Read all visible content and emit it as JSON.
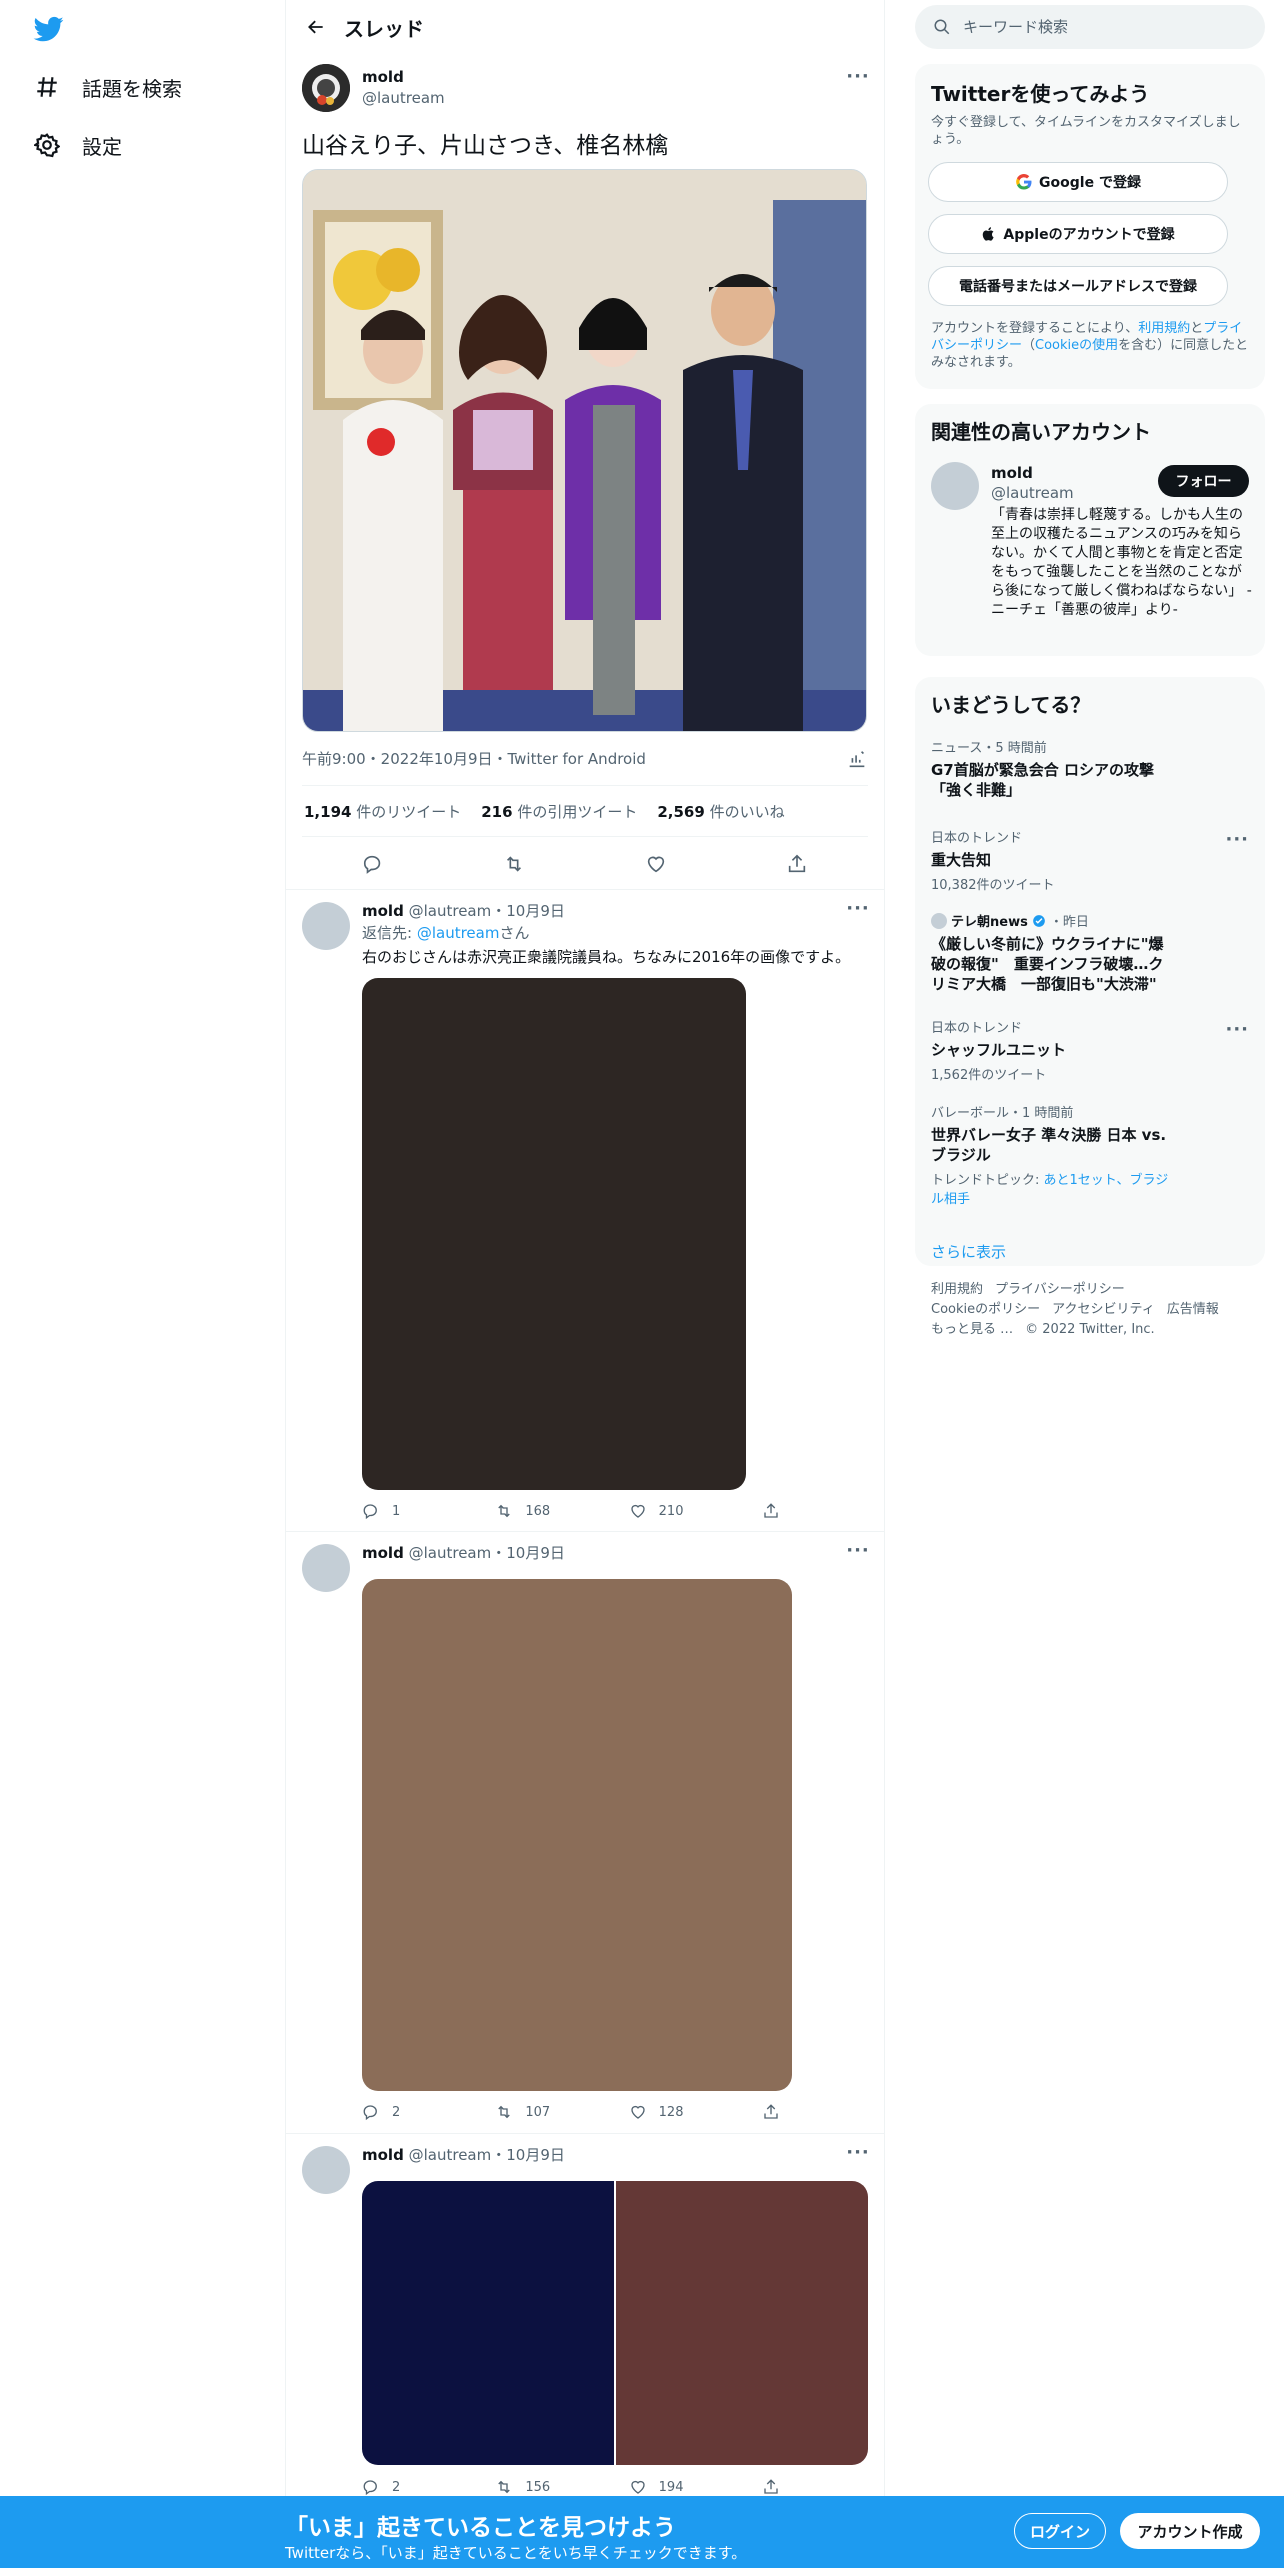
{
  "nav": {
    "explore_label": "話題を検索",
    "settings_label": "設定"
  },
  "header": {
    "title": "スレッド"
  },
  "main_tweet": {
    "name": "mold",
    "handle": "@lautream",
    "text": "山谷えり子、片山さつき、椎名林檎",
    "meta": "午前9:00・2022年10月9日・Twitter for Android",
    "retweets": "1,194",
    "retweets_label": "件のリツイート",
    "quotes": "216",
    "quotes_label": "件の引用ツイート",
    "likes": "2,569",
    "likes_label": "件のいいね"
  },
  "replies": [
    {
      "name": "mold",
      "handle": "@lautream",
      "date": "・10月9日",
      "reply_to_prefix": "返信先: ",
      "reply_to_handle": "@lautream",
      "reply_to_suffix": "さん",
      "text": "右のおじさんは赤沢亮正衆議院議員ね。ちなみに2016年の画像ですよ。",
      "replies": "1",
      "retweets": "168",
      "likes": "210",
      "media_color": "#2d2623"
    },
    {
      "name": "mold",
      "handle": "@lautream",
      "date": "・10月9日",
      "replies": "2",
      "retweets": "107",
      "likes": "128",
      "media_color": "#8b6d58"
    },
    {
      "name": "mold",
      "handle": "@lautream",
      "date": "・10月9日",
      "replies": "2",
      "retweets": "156",
      "likes": "194",
      "media_color_left": "#0c1140",
      "media_color_right": "#643836"
    }
  ],
  "search": {
    "placeholder": "キーワード検索"
  },
  "signup_card": {
    "title": "Twitterを使ってみよう",
    "desc": "今すぐ登録して、タイムラインをカスタマイズしましょう。",
    "google_btn": "Google で登録",
    "apple_btn": "Appleのアカウントで登録",
    "phone_btn": "電話番号またはメールアドレスで登録",
    "legal_prefix": "アカウントを登録することにより、",
    "legal_terms": "利用規約",
    "legal_and": "と",
    "legal_privacy": "プライバシーポリシー",
    "legal_paren_open": "（",
    "legal_cookie": "Cookieの使用",
    "legal_suffix": "を含む）に同意したとみなされます。"
  },
  "related_card": {
    "title": "関連性の高いアカウント",
    "name": "mold",
    "handle": "@lautream",
    "follow": "フォロー",
    "bio": "「青春は崇拝し軽蔑する。しかも人生の至上の収穫たるニュアンスの巧みを知らない。かくて人間と事物とを肯定と否定をもって強襲したことを当然のことながら後になって厳しく償わねばならない」 -ニーチェ「善悪の彼岸」より-"
  },
  "trends_card": {
    "title": "いまどうしてる？",
    "items": [
      {
        "context": "ニュース・5 時間前",
        "title": "G7首脳が緊急会合 ロシアの攻撃「強く非難」"
      },
      {
        "context": "日本のトレンド",
        "title": "重大告知",
        "count": "10,382件のツイート"
      },
      {
        "source": "テレ朝news",
        "time": "・昨日",
        "title": "《厳しい冬前に》ウクライナに\"爆破の報復\"　重要インフラ破壊…クリミア大橋　一部復旧も\"大渋滞\""
      },
      {
        "context": "日本のトレンド",
        "title": "シャッフルユニット",
        "count": "1,562件のツイート"
      },
      {
        "context": "バレーボール・1 時間前",
        "title": "世界バレー女子 準々決勝 日本 vs. ブラジル",
        "topic_prefix": "トレンドトピック: ",
        "topic": "あと1セット、ブラジル相手"
      }
    ],
    "show_more": "さらに表示"
  },
  "footer": {
    "terms": "利用規約",
    "privacy": "プライバシーポリシー",
    "cookie": "Cookieのポリシー",
    "accessibility": "アクセシビリティ",
    "ads": "広告情報",
    "more": "もっと見る …",
    "copyright": "© 2022 Twitter, Inc."
  },
  "bottom_bar": {
    "title": "「いま」起きていることを見つけよう",
    "subtitle": "Twitterなら、「いま」起きていることをいち早くチェックできます。",
    "login": "ログイン",
    "signup": "アカウント作成"
  },
  "colors": {
    "accent": "#1d9bf0",
    "text": "#0f1419",
    "muted": "#536471"
  }
}
